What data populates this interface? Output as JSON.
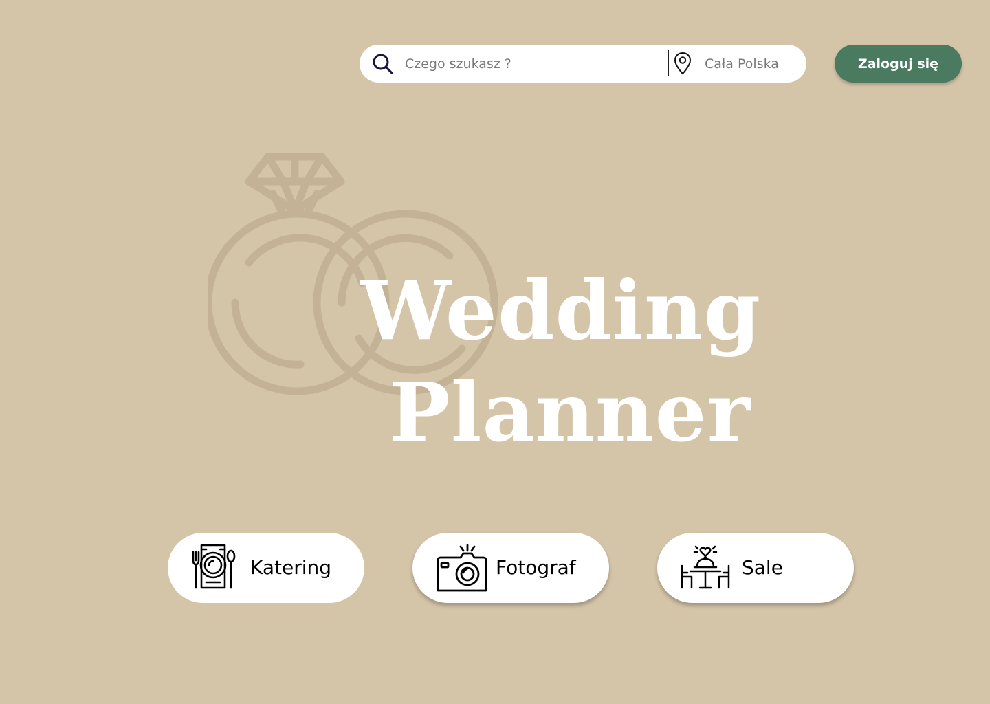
{
  "search": {
    "query_placeholder": "Czego szukasz ?",
    "location_placeholder": "Cała Polska",
    "search_icon": "search-icon",
    "location_icon": "map-pin-icon"
  },
  "header": {
    "login_label": "Zaloguj się"
  },
  "hero": {
    "title_line1": "Wedding",
    "title_line2": "Planner",
    "logo_icon": "wedding-rings-icon"
  },
  "categories": [
    {
      "label": "Katering",
      "icon": "catering-plate-icon"
    },
    {
      "label": "Fotograf",
      "icon": "camera-icon"
    },
    {
      "label": "Sale",
      "icon": "dinner-table-icon"
    }
  ],
  "colors": {
    "background": "#d4c4a8",
    "accent": "#4a7b61",
    "logo": "#c4b296",
    "search_icon": "#1a1240"
  }
}
